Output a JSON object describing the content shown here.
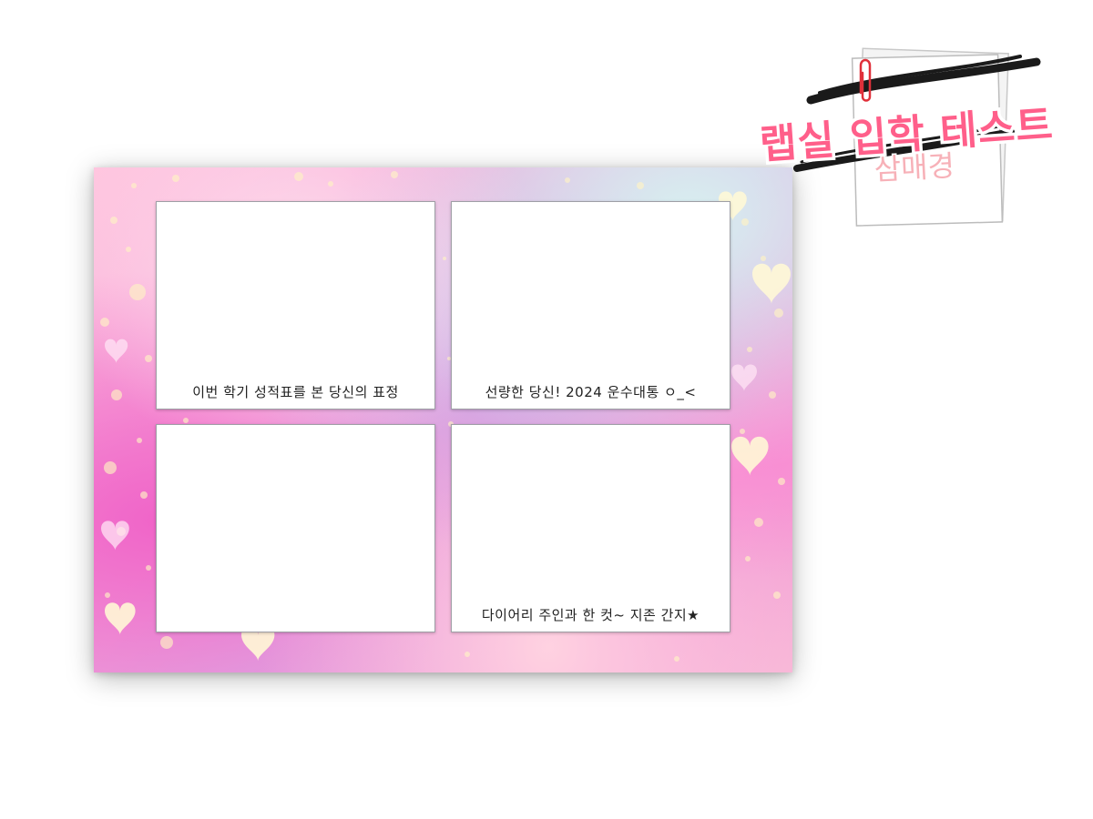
{
  "title": {
    "main": "랩실 입학 테스트",
    "sub": "삼매경"
  },
  "photos": [
    {
      "caption": "이번 학기 성적표를 본 당신의 표정"
    },
    {
      "caption": "선량한 당신! 2024 운수대통 ㅇ_<"
    },
    {
      "caption": ""
    },
    {
      "caption": "다이어리 주인과 한 컷~ 지존 간지★"
    }
  ],
  "colors": {
    "title_fill": "#ff5f8a",
    "title_outline": "#ffffff",
    "sub_fill": "#f7b1b8",
    "clip": "#e0303a"
  }
}
